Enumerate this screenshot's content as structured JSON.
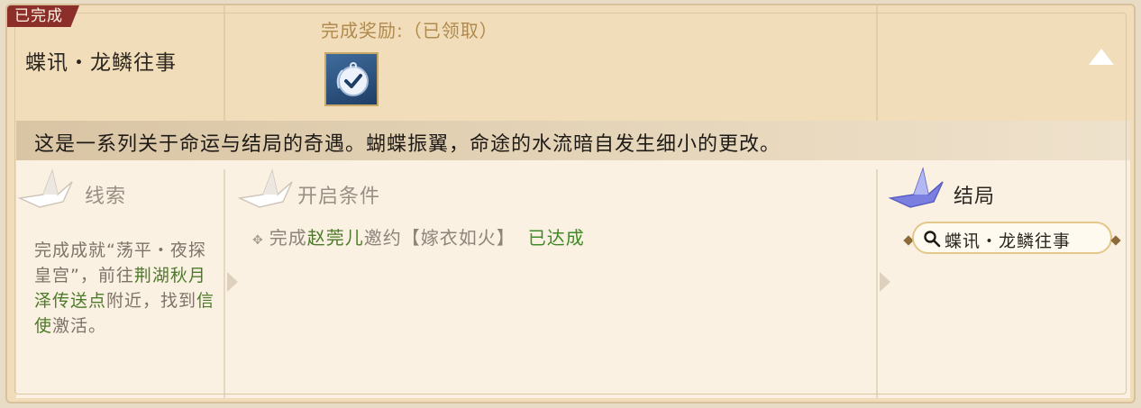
{
  "status_tag": "已完成",
  "quest": {
    "title": "蝶讯・龙鳞往事",
    "reward_label": "完成奖励:（已领取）",
    "description": "这是一系列关于命运与结局的奇遇。蝴蝶振翼，命途的水流暗自发生细小的更改。"
  },
  "clues": {
    "header": "线索",
    "text_1": "完成成就“荡平・夜探皇宫”，前往",
    "location": "荆湖秋月泽传送点",
    "text_2": "附近，找到",
    "npc": "信使",
    "text_3": "激活。"
  },
  "conditions": {
    "header": "开启条件",
    "prefix": "完成",
    "npc_name": "赵莞儿",
    "quest_name": "邀约【嫁衣如火】",
    "status": "已达成"
  },
  "ending": {
    "header": "结局",
    "item_label": "蝶讯・龙鳞往事"
  },
  "icons": {
    "reward": "check-badge-icon",
    "toggle": "collapse-up-icon",
    "search": "magnifier-icon",
    "crane": "paper-crane-icon"
  },
  "colors": {
    "status_tag": "#8c2f2a",
    "highlight_green": "#4d7a2a",
    "achieved_green": "#3f8a25",
    "ending_crane": "#7b7fe0"
  }
}
